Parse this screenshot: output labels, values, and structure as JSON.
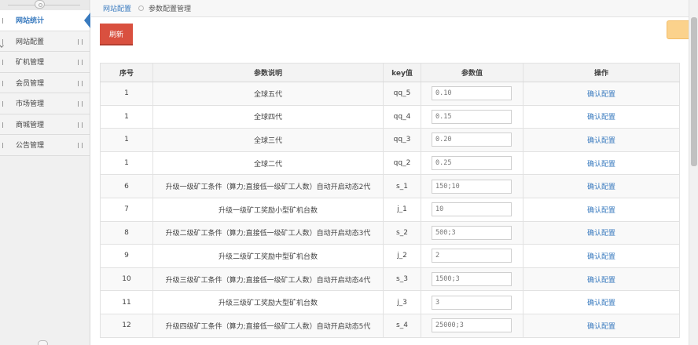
{
  "sidebar": {
    "items": [
      {
        "label": "网站统计",
        "active": true
      },
      {
        "label": "网站配置",
        "active": false
      },
      {
        "label": "矿机管理",
        "active": false
      },
      {
        "label": "会员管理",
        "active": false
      },
      {
        "label": "市场管理",
        "active": false
      },
      {
        "label": "商城管理",
        "active": false
      },
      {
        "label": "公告管理",
        "active": false
      }
    ]
  },
  "breadcrumb": {
    "link": "网站配置",
    "current": "参数配置管理"
  },
  "toolbar": {
    "refresh_label": "刷新"
  },
  "table": {
    "headers": [
      "序号",
      "参数说明",
      "key值",
      "参数值",
      "操作"
    ],
    "rows": [
      {
        "no": "1",
        "desc": "全球五代",
        "key": "qq_5",
        "value": "0.10",
        "action": "确认配置"
      },
      {
        "no": "1",
        "desc": "全球四代",
        "key": "qq_4",
        "value": "0.15",
        "action": "确认配置"
      },
      {
        "no": "1",
        "desc": "全球三代",
        "key": "qq_3",
        "value": "0.20",
        "action": "确认配置"
      },
      {
        "no": "1",
        "desc": "全球二代",
        "key": "qq_2",
        "value": "0.25",
        "action": "确认配置"
      },
      {
        "no": "6",
        "desc": "升级一级矿工条件（算力;直接低一级矿工人数）自动开启动态2代",
        "key": "s_1",
        "value": "150;10",
        "action": "确认配置"
      },
      {
        "no": "7",
        "desc": "升级一级矿工奖励小型矿机台数",
        "key": "j_1",
        "value": "10",
        "action": "确认配置"
      },
      {
        "no": "8",
        "desc": "升级二级矿工条件（算力;直接低一级矿工人数）自动开启动态3代",
        "key": "s_2",
        "value": "500;3",
        "action": "确认配置"
      },
      {
        "no": "9",
        "desc": "升级二级矿工奖励中型矿机台数",
        "key": "j_2",
        "value": "2",
        "action": "确认配置"
      },
      {
        "no": "10",
        "desc": "升级三级矿工条件（算力;直接低一级矿工人数）自动开启动态4代",
        "key": "s_3",
        "value": "1500;3",
        "action": "确认配置"
      },
      {
        "no": "11",
        "desc": "升级三级矿工奖励大型矿机台数",
        "key": "j_3",
        "value": "3",
        "action": "确认配置"
      },
      {
        "no": "12",
        "desc": "升级四级矿工条件（算力;直接低一级矿工人数）自动开启动态5代",
        "key": "s_4",
        "value": "25000;3",
        "action": "确认配置"
      }
    ]
  },
  "colors": {
    "accent": "#3a7bbf",
    "refresh_button": "#d9503f",
    "notice_tab": "#fbd28c"
  }
}
